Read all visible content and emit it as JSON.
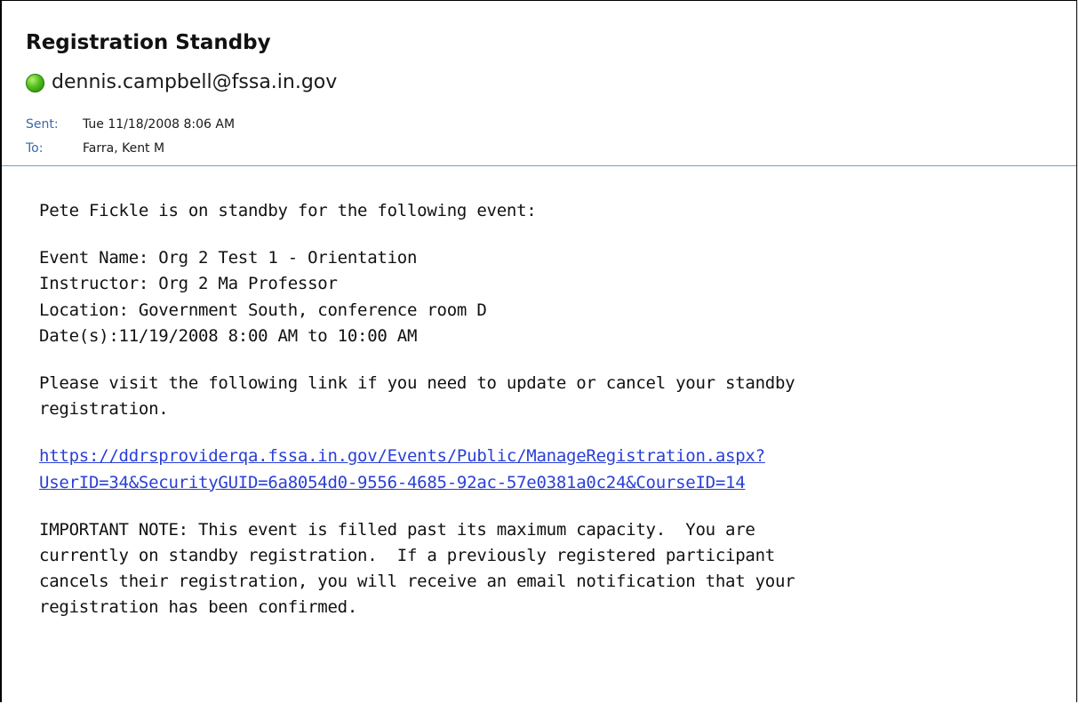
{
  "email": {
    "subject": "Registration Standby",
    "sender": "dennis.campbell@fssa.in.gov",
    "sent_label": "Sent:",
    "sent_value": "Tue 11/18/2008 8:06 AM",
    "to_label": "To:",
    "to_value": "Farra, Kent M",
    "presence_icon": "green-presence-dot",
    "colors": {
      "meta_label": "#3b68a8",
      "separator": "#6f9fd1",
      "link": "#2a3fd6",
      "presence": "#3aa612"
    }
  },
  "body": {
    "intro": "Pete Fickle is on standby for the following event:",
    "event_name": "Event Name: Org 2 Test 1 - Orientation",
    "instructor": "Instructor: Org 2 Ma Professor",
    "location": "Location: Government South, conference room D",
    "dates": "Date(s):11/19/2008 8:00 AM to 10:00 AM",
    "visit_line1": "Please visit the following link if you need to update or cancel your standby",
    "visit_line2": "registration.",
    "link_line1": "https://ddrsproviderqa.fssa.in.gov/Events/Public/ManageRegistration.aspx?",
    "link_line2": "UserID=34&SecurityGUID=6a8054d0-9556-4685-92ac-57e0381a0c24&CourseID=14",
    "note_line1": "IMPORTANT NOTE: This event is filled past its maximum capacity.  You are",
    "note_line2": "currently on standby registration.  If a previously registered participant",
    "note_line3": "cancels their registration, you will receive an email notification that your",
    "note_line4": "registration has been confirmed."
  }
}
